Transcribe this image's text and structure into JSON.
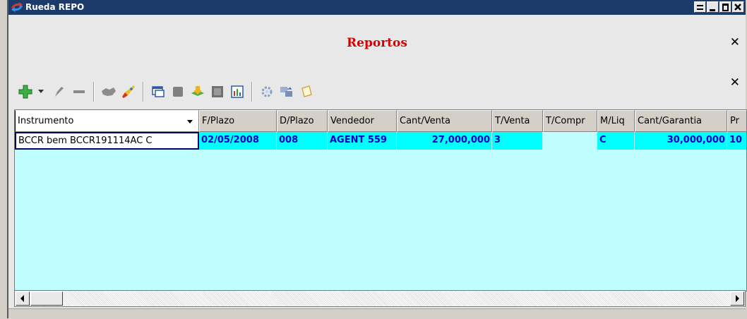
{
  "window": {
    "title": "Rueda REPO"
  },
  "panel": {
    "title": "Reportos",
    "close_label": "✕",
    "toolbar_close_label": "✕"
  },
  "toolbar": {
    "buttons": [
      "add-icon",
      "dropdown-arrow-icon",
      "edit-icon",
      "remove-icon",
      "handshake-icon",
      "rocket-icon",
      "copy-window-icon",
      "stop-icon",
      "export-icon",
      "filmstrip-icon",
      "bar-chart-icon",
      "settings-icon",
      "transfer-icon",
      "notepad-icon"
    ]
  },
  "grid": {
    "columns": [
      "Instrumento",
      "F/Plazo",
      "D/Plazo",
      "Vendedor",
      "Cant/Venta",
      "T/Venta",
      "T/Compr",
      "M/Liq",
      "Cant/Garantia",
      "Pr"
    ],
    "rows": [
      [
        "BCCR bem BCCR191114AC C",
        "02/05/2008",
        "008",
        "AGENT 559",
        "27,000,000",
        "3",
        "",
        "C",
        "30,000,000",
        "10"
      ]
    ],
    "colors": {
      "body_bg": "#c0ffff",
      "row_bg": "#00ffff",
      "row_text": "#0000cc"
    }
  },
  "colors": {
    "titlebar": "#1c3b6b",
    "report_title": "#d80000"
  }
}
